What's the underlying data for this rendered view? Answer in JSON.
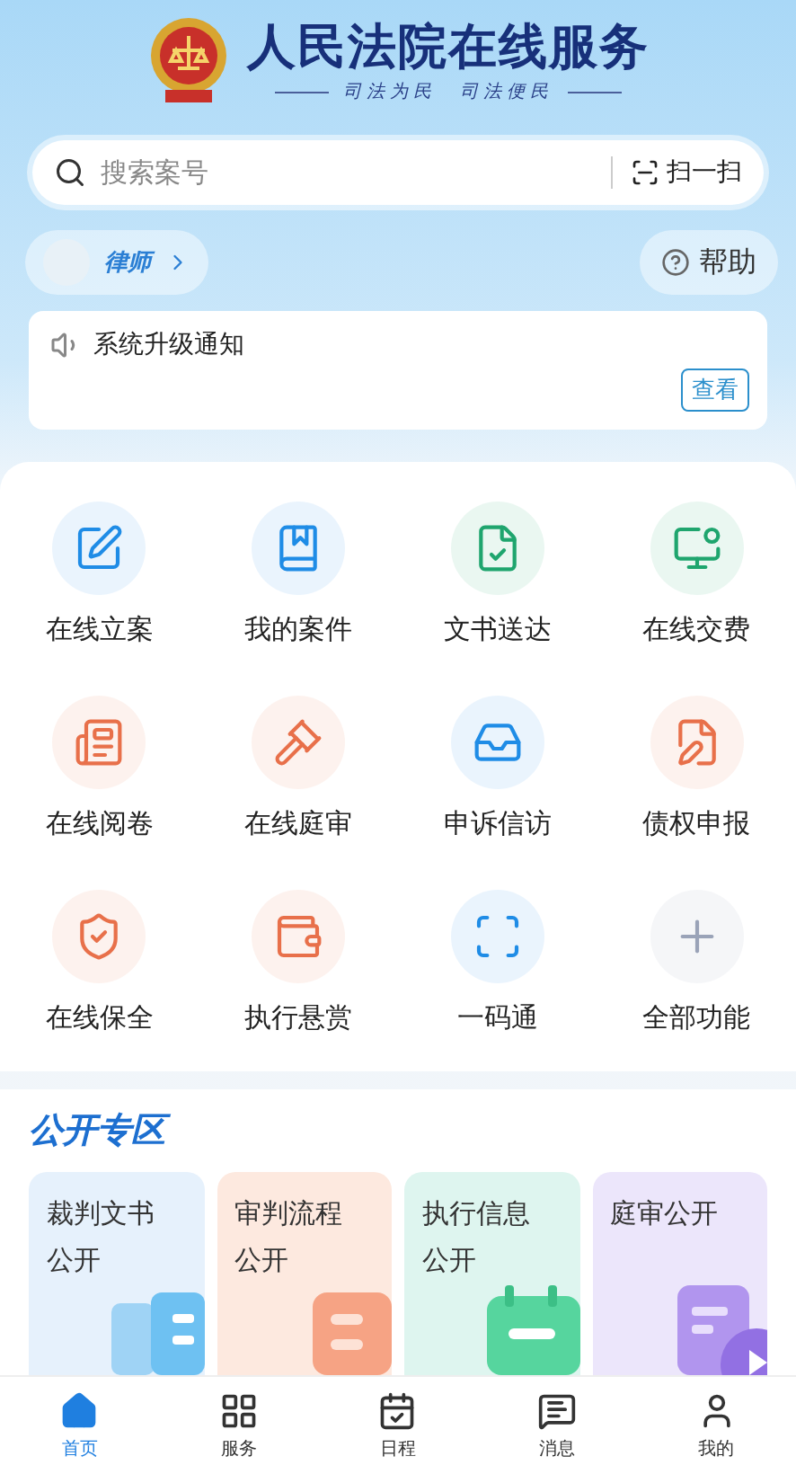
{
  "header": {
    "title": "人民法院在线服务",
    "slogan": "司法为民　司法便民"
  },
  "search": {
    "placeholder": "搜索案号",
    "scan_label": "扫一扫"
  },
  "user": {
    "role": "律师"
  },
  "help": {
    "label": "帮助"
  },
  "notice": {
    "text": "系统升级通知",
    "button": "查看"
  },
  "services": [
    {
      "label": "在线立案",
      "kind": "edit",
      "color": "#1f8ce6"
    },
    {
      "label": "我的案件",
      "kind": "book",
      "color": "#1f8ce6"
    },
    {
      "label": "文书送达",
      "kind": "doc",
      "color": "#1fa56e"
    },
    {
      "label": "在线交费",
      "kind": "pay",
      "color": "#1fa56e"
    },
    {
      "label": "在线阅卷",
      "kind": "read",
      "color": "#e8704a"
    },
    {
      "label": "在线庭审",
      "kind": "court",
      "color": "#e8704a"
    },
    {
      "label": "申诉信访",
      "kind": "petition",
      "color": "#1f8ce6"
    },
    {
      "label": "债权申报",
      "kind": "claim",
      "color": "#e8704a"
    },
    {
      "label": "在线保全",
      "kind": "guard",
      "color": "#e8704a"
    },
    {
      "label": "执行悬赏",
      "kind": "reward",
      "color": "#e8704a"
    },
    {
      "label": "一码通",
      "kind": "code",
      "color": "#1f8ce6"
    },
    {
      "label": "全部功能",
      "kind": "all",
      "color": "#9aa3b8"
    }
  ],
  "public_section": {
    "title": "公开专区",
    "cards": [
      {
        "label": "裁判文书公开",
        "kind": "book",
        "color": "#e6f1fc"
      },
      {
        "label": "审判流程公开",
        "kind": "flow",
        "color": "#fde9df"
      },
      {
        "label": "执行信息公开",
        "kind": "calendar",
        "color": "#def5ef"
      },
      {
        "label": "庭审公开",
        "kind": "video",
        "color": "#ece6fb"
      }
    ]
  },
  "tab_bar": [
    {
      "label": "首页",
      "kind": "home",
      "selected": true
    },
    {
      "label": "服务",
      "kind": "grid",
      "selected": false
    },
    {
      "label": "日程",
      "kind": "schedule",
      "selected": false
    },
    {
      "label": "消息",
      "kind": "message",
      "selected": false
    },
    {
      "label": "我的",
      "kind": "user",
      "selected": false
    }
  ]
}
